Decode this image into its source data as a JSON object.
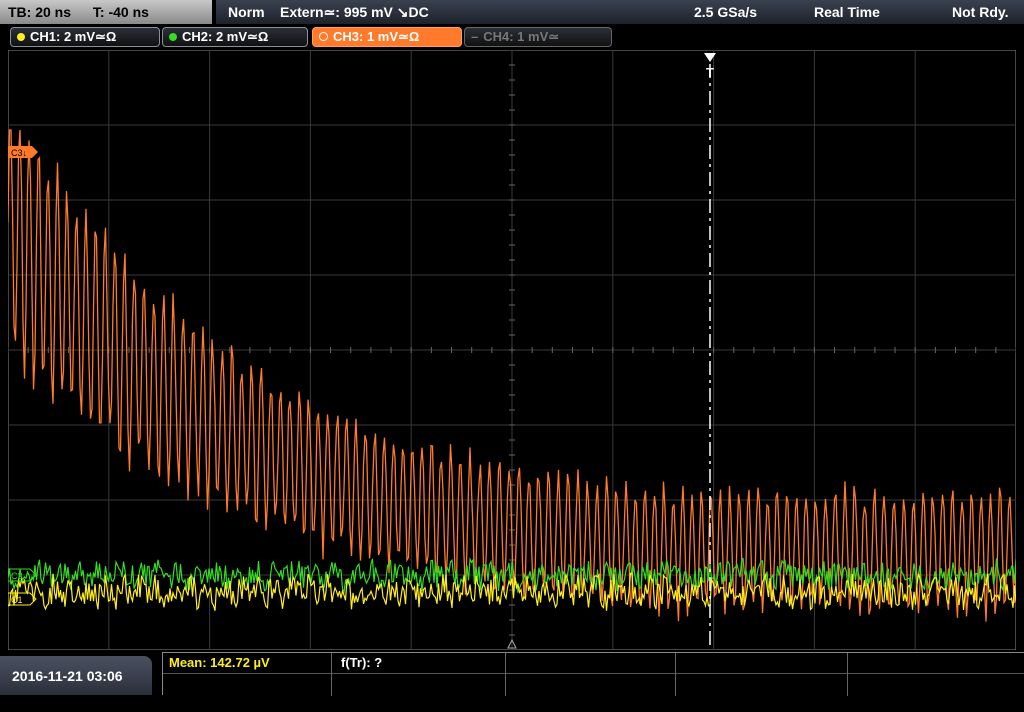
{
  "timebase": {
    "tb_label": "TB: 20 ns",
    "trigger_offset": "T: -40 ns"
  },
  "acquisition": {
    "mode": "Norm",
    "trigger": "Extern≃: 995 mV ↘DC",
    "sample_rate": "2.5 GSa/s",
    "acq_mode": "Real Time",
    "status": "Not Rdy."
  },
  "channels": [
    {
      "label": "CH1: 2 mV≃Ω",
      "color": "#ffee22",
      "active": false
    },
    {
      "label": "CH2: 2 mV≃Ω",
      "color": "#33dd22",
      "active": false
    },
    {
      "label": "CH3: 1 mV≃Ω",
      "color": "#ff7a2a",
      "active": true
    },
    {
      "label": "CH4: 1 mV≃",
      "color": "#777777",
      "active": false
    }
  ],
  "markers": {
    "ch3_ref": "C3↓",
    "ch2_ref": "C2",
    "ch1_ref": "C1",
    "trigger_marker": "T"
  },
  "measurement": {
    "mean_label": "Mean: 142.72 µV",
    "f_label": "f(Tr): ?"
  },
  "datetime": "2016-11-21 03:06",
  "colors": {
    "ch1": "#ffee22",
    "ch2": "#33dd22",
    "ch3": "#ff7a2a",
    "grid": "#3a3a3a"
  }
}
